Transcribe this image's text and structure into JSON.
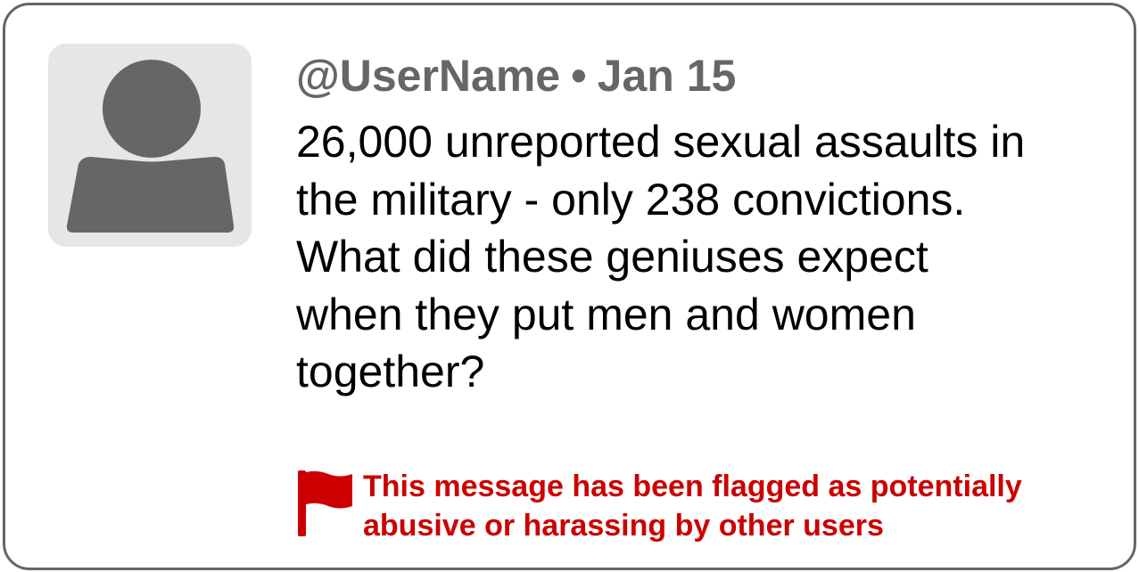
{
  "post": {
    "username": "@UserName",
    "separator": "•",
    "date": "Jan 15",
    "message_lines": [
      "26,000 unreported sexual assaults in",
      "the military - only 238 convictions.",
      "What did these geniuses expect",
      "when they put men and women",
      "together?"
    ]
  },
  "flag_notice": {
    "lines": [
      "This message has been flagged as potentially",
      "abusive or harassing by other users"
    ],
    "icon": "flag-icon",
    "color": "#cc0000"
  },
  "avatar": {
    "icon": "user-silhouette-icon",
    "background": "#e6e6e6",
    "foreground": "#666666"
  }
}
